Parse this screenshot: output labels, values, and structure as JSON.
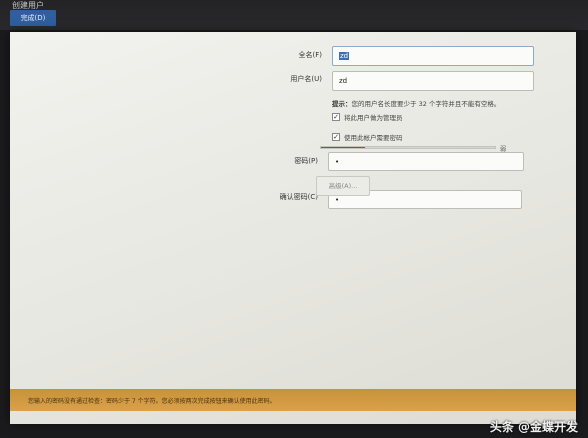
{
  "window": {
    "title": "创建用户",
    "done_label": "完成(D)"
  },
  "form": {
    "fullname_label": "全名(F)",
    "fullname_value": "zd",
    "username_label": "用户名(U)",
    "username_value": "zd",
    "hint_bold": "提示：",
    "hint_text": "您的用户名长度要少于 32 个字符并且不能有空格。",
    "admin_checkbox_label": "将此用户做为管理员",
    "require_password_label": "使用此帐户需要密码",
    "password_label": "密码(P)",
    "password_value": "•",
    "strength_fraction": 0.25,
    "strength_text": "弱",
    "confirm_label": "确认密码(C)",
    "confirm_value": "•",
    "advanced_label": "高级(A)..."
  },
  "status_bar": {
    "text": "您输入的密码没有通过检查：密码少于 7 个字符。您必须按两次完成按钮来确认使用此密码。"
  },
  "watermark": {
    "text": "头条 @金蝶开发"
  }
}
